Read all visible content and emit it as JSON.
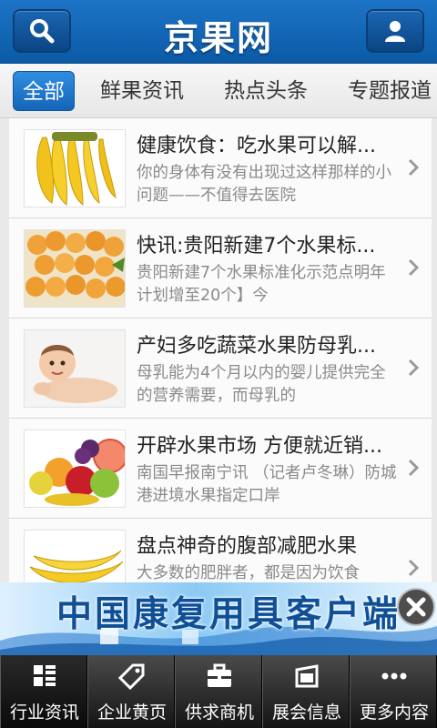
{
  "header": {
    "logo_text": "京果网",
    "search_icon": "search-icon",
    "user_icon": "user-icon"
  },
  "tabs": [
    {
      "label": "全部",
      "active": true
    },
    {
      "label": "鲜果资讯",
      "active": false
    },
    {
      "label": "热点头条",
      "active": false
    },
    {
      "label": "专题报道",
      "active": false
    }
  ],
  "articles": [
    {
      "title": "健康饮食：吃水果可以解...",
      "desc": "你的身体有没有出现过这样那样的小问题——不值得去医院",
      "thumb": "bananas"
    },
    {
      "title": "快讯:贵阳新建7个水果标...",
      "desc": "贵阳新建7个水果标准化示范点明年计划增至20个】今",
      "thumb": "loquats"
    },
    {
      "title": "产妇多吃蔬菜水果防母乳...",
      "desc": "母乳能为4个月以内的婴儿提供完全的营养需要，而母乳的",
      "thumb": "baby"
    },
    {
      "title": "开辟水果市场 方便就近销...",
      "desc": "南国早报南宁讯 （记者卢冬琳）防城港进境水果指定口岸",
      "thumb": "mixed-fruit"
    },
    {
      "title": "盘点神奇的腹部减肥水果",
      "desc": "大多数的肥胖者，都是因为饮食",
      "thumb": "banana"
    }
  ],
  "ad": {
    "title": "中国康复用具客户端",
    "close_icon": "close-icon"
  },
  "bottom_nav": [
    {
      "label": "行业资讯",
      "icon": "grid-icon",
      "active": true
    },
    {
      "label": "企业黄页",
      "icon": "tag-icon",
      "active": false
    },
    {
      "label": "供求商机",
      "icon": "briefcase-icon",
      "active": false
    },
    {
      "label": "展会信息",
      "icon": "calendar-icon",
      "active": false
    },
    {
      "label": "更多内容",
      "icon": "more-icon",
      "active": false
    }
  ],
  "colors": {
    "header_blue": "#1366b8",
    "tab_active": "#1f7ad1",
    "nav_dark": "#1e1e1e"
  }
}
